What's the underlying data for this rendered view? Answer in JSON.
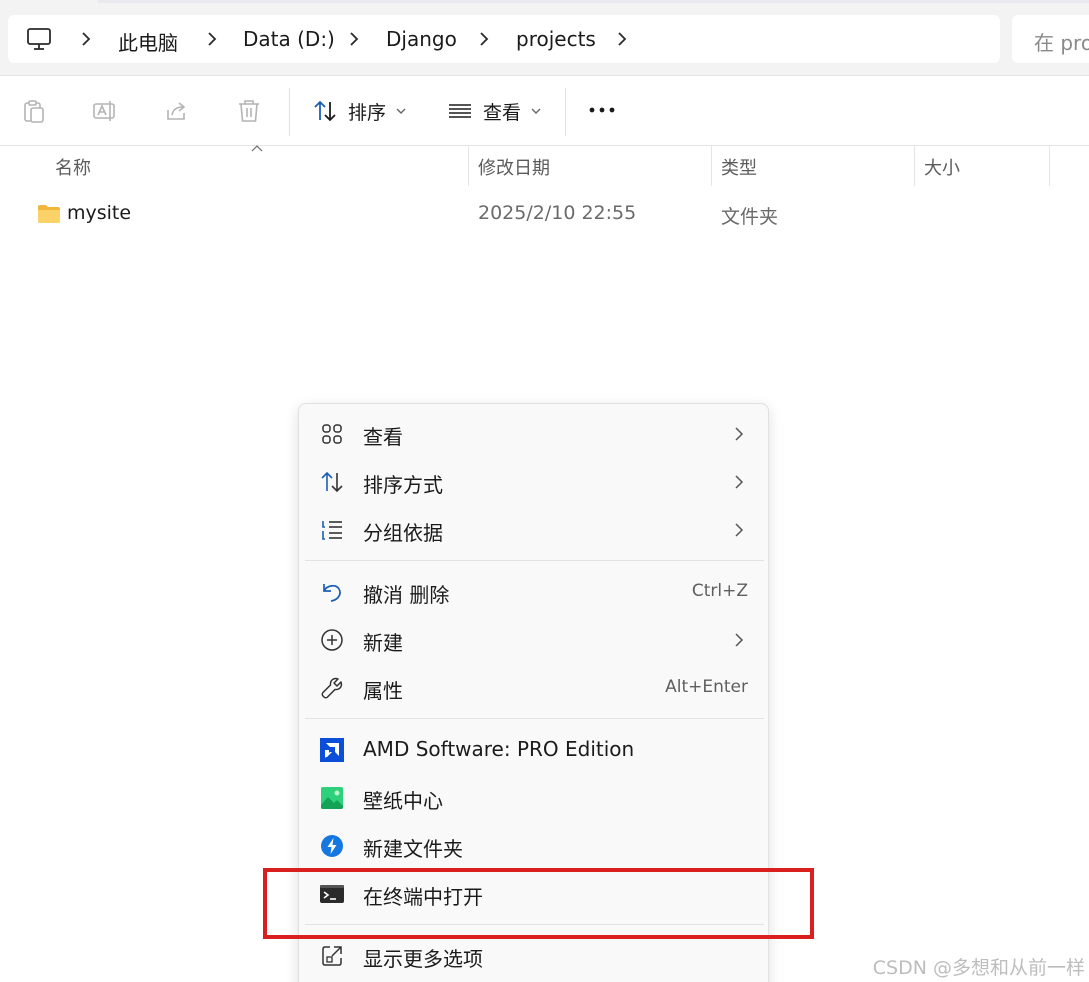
{
  "address_bar": {
    "breadcrumbs": [
      "此电脑",
      "Data (D:)",
      "Django",
      "projects"
    ],
    "pc_icon": "computer-icon",
    "separator_icon": "chevron-right-icon"
  },
  "search": {
    "placeholder_partial": "在 pro"
  },
  "toolbar": {
    "buttons": [
      {
        "icon": "paste-icon",
        "enabled": false
      },
      {
        "icon": "rename-icon",
        "enabled": false
      },
      {
        "icon": "share-icon",
        "enabled": false
      },
      {
        "icon": "delete-icon",
        "enabled": false
      }
    ],
    "sort_label": "排序",
    "view_label": "查看",
    "more_icon": "more-horizontal-icon"
  },
  "columns": {
    "name": "名称",
    "modified": "修改日期",
    "type": "类型",
    "size": "大小"
  },
  "files": [
    {
      "name": "mysite",
      "modified": "2025/2/10 22:55",
      "type": "文件夹",
      "icon": "folder-icon"
    }
  ],
  "context_menu": {
    "group1": [
      {
        "label": "查看",
        "icon": "grid-view-icon",
        "submenu": true
      },
      {
        "label": "排序方式",
        "icon": "sort-icon",
        "submenu": true
      },
      {
        "label": "分组依据",
        "icon": "group-by-icon",
        "submenu": true
      }
    ],
    "group2": [
      {
        "label": "撤消 删除",
        "icon": "undo-icon",
        "shortcut": "Ctrl+Z"
      },
      {
        "label": "新建",
        "icon": "add-circle-icon",
        "submenu": true
      },
      {
        "label": "属性",
        "icon": "wrench-icon",
        "shortcut": "Alt+Enter"
      }
    ],
    "group3": [
      {
        "label": "AMD Software: PRO Edition",
        "icon": "amd-icon"
      },
      {
        "label": "壁纸中心",
        "icon": "wallpaper-icon"
      },
      {
        "label": "新建文件夹",
        "icon": "new-folder-app-icon"
      },
      {
        "label": "在终端中打开",
        "icon": "terminal-icon"
      }
    ],
    "group4": [
      {
        "label": "显示更多选项",
        "icon": "show-more-options-icon"
      }
    ]
  },
  "highlight": {
    "target": "在终端中打开",
    "color": "#d9201f"
  },
  "watermark": "CSDN @多想和从前一样",
  "colors": {
    "accent": "#0067c0",
    "folder": "#f8c74a",
    "highlight": "#d9201f"
  }
}
